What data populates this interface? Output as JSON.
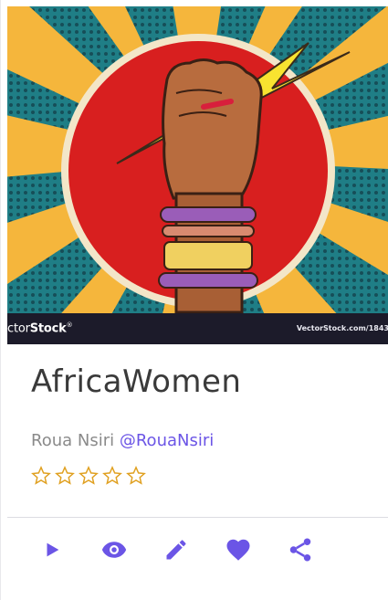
{
  "colors": {
    "accent": "#6b55e6",
    "star": "#e0a020",
    "title": "#3a3a3a",
    "author_name": "#8a8a8a"
  },
  "cover": {
    "watermark_left_prefix": "ctor",
    "watermark_left_bold": "Stock",
    "watermark_left_suffix": "®",
    "watermark_right": "VectorStock.com/1843"
  },
  "card": {
    "title": "AfricaWomen",
    "author_name": "Roua Nsiri",
    "author_handle": "@RouaNsiri",
    "rating": 0,
    "rating_max": 5
  },
  "actions": [
    {
      "name": "play",
      "icon": "play-icon"
    },
    {
      "name": "view",
      "icon": "eye-icon"
    },
    {
      "name": "edit",
      "icon": "pencil-icon"
    },
    {
      "name": "like",
      "icon": "heart-icon"
    },
    {
      "name": "share",
      "icon": "share-icon"
    }
  ]
}
